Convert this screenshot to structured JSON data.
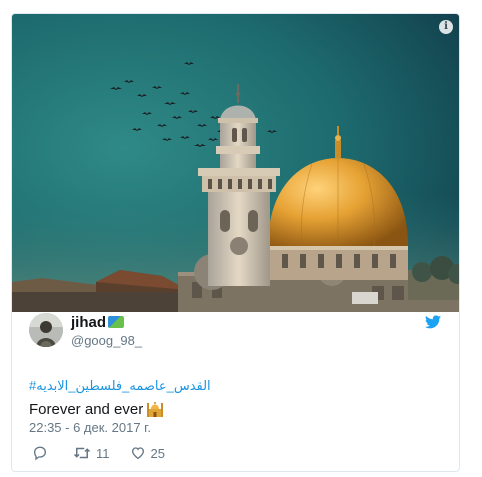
{
  "media": {
    "alt_icon": "photo-of-dome-of-the-rock",
    "info_glyph": "i"
  },
  "user": {
    "display_name": "jihad",
    "handle": "@goog_98_",
    "badge_icon": "map-flag-emoji"
  },
  "tweet": {
    "hashtag": "#القدس_عاصمه_فلسطين_الابديه",
    "text": "Forever and ever",
    "emoji_icon": "mosque-emoji",
    "timestamp": "22:35 - 6 дек. 2017 г."
  },
  "actions": {
    "reply_icon": "reply-icon",
    "retweet_icon": "retweet-icon",
    "retweet_count": "11",
    "like_icon": "heart-icon",
    "like_count": "25"
  },
  "colors": {
    "sky": "#1f6e72",
    "dome_gold": "#e0a437",
    "link_blue": "#1b95e0",
    "twitter_blue": "#1da1f2",
    "muted": "#657786"
  }
}
